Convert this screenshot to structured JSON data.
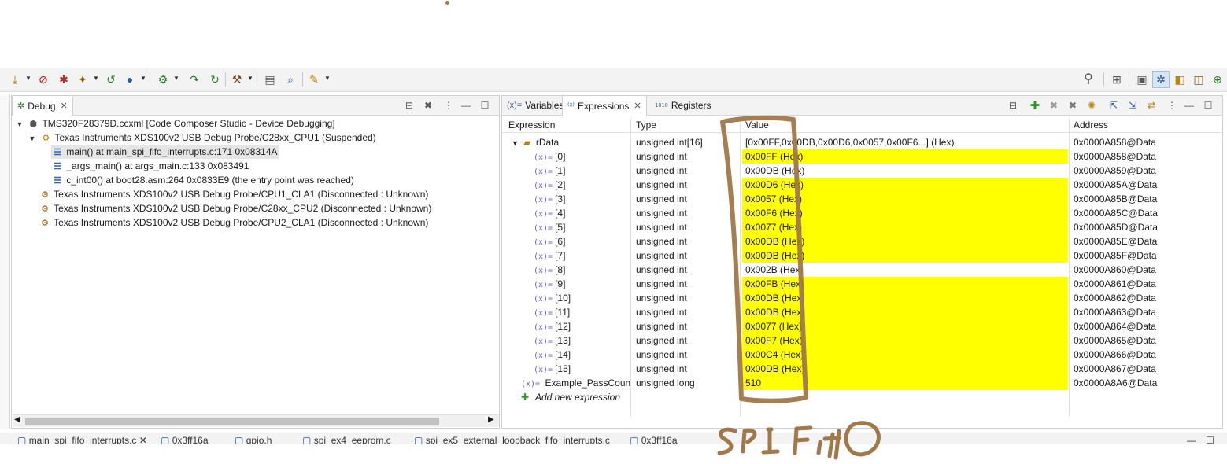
{
  "toolbar": {
    "left_icons": [
      "download-icon",
      "stop-sign-icon",
      "cpu-icon",
      "step-return-icon",
      "run-icon",
      "gear-icon",
      "step-over-icon",
      "restart-icon",
      "hammer-icon",
      "memory-icon",
      "search-target-icon",
      "wand-icon"
    ],
    "right_icons": [
      "search-icon",
      "open-perspective-icon",
      "debug-perspective-icon",
      "ccs-edit-icon",
      "ccs-debug-icon",
      "ccs-simple-icon",
      "ccs-plus-icon"
    ]
  },
  "debug_view": {
    "tab_label": "Debug",
    "tree": [
      {
        "label": "TMS320F28379D.ccxml [Code Composer Studio - Device Debugging]",
        "icon": "launch-icon"
      },
      {
        "label": "Texas Instruments XDS100v2 USB Debug Probe/C28xx_CPU1 (Suspended)",
        "icon": "thread-icon"
      },
      {
        "label": "main() at main_spi_fifo_interrupts.c:171 0x08314A",
        "icon": "stack-frame-icon"
      },
      {
        "label": "_args_main() at args_main.c:133 0x083491",
        "icon": "stack-frame-icon"
      },
      {
        "label": "c_int00() at boot28.asm:264 0x0833E9  (the entry point was reached)",
        "icon": "stack-frame-icon"
      },
      {
        "label": "Texas Instruments XDS100v2 USB Debug Probe/CPU1_CLA1 (Disconnected : Unknown)",
        "icon": "disconnected-icon"
      },
      {
        "label": "Texas Instruments XDS100v2 USB Debug Probe/C28xx_CPU2 (Disconnected : Unknown)",
        "icon": "disconnected-icon"
      },
      {
        "label": "Texas Instruments XDS100v2 USB Debug Probe/CPU2_CLA1 (Disconnected : Unknown)",
        "icon": "disconnected-icon"
      }
    ]
  },
  "expressions_view": {
    "tabs": [
      {
        "label": "Variables",
        "icon": "(x)="
      },
      {
        "label": "Expressions",
        "icon": "×"
      },
      {
        "label": "Registers",
        "icon": "1010"
      }
    ],
    "columns": [
      "Expression",
      "Type",
      "Value",
      "Address"
    ],
    "parent": {
      "name": "rData",
      "type": "unsigned int[16]",
      "value": "[0x00FF,0x00DB,0x00D6,0x0057,0x00F6...] (Hex)",
      "address": "0x0000A858@Data"
    },
    "rows": [
      {
        "name": "[0]",
        "type": "unsigned int",
        "value": "0x00FF (Hex)",
        "address": "0x0000A858@Data",
        "changed": true
      },
      {
        "name": "[1]",
        "type": "unsigned int",
        "value": "0x00DB (Hex)",
        "address": "0x0000A859@Data",
        "changed": false
      },
      {
        "name": "[2]",
        "type": "unsigned int",
        "value": "0x00D6 (Hex)",
        "address": "0x0000A85A@Data",
        "changed": true
      },
      {
        "name": "[3]",
        "type": "unsigned int",
        "value": "0x0057 (Hex)",
        "address": "0x0000A85B@Data",
        "changed": true
      },
      {
        "name": "[4]",
        "type": "unsigned int",
        "value": "0x00F6 (Hex)",
        "address": "0x0000A85C@Data",
        "changed": true
      },
      {
        "name": "[5]",
        "type": "unsigned int",
        "value": "0x0077 (Hex)",
        "address": "0x0000A85D@Data",
        "changed": true
      },
      {
        "name": "[6]",
        "type": "unsigned int",
        "value": "0x00DB (Hex)",
        "address": "0x0000A85E@Data",
        "changed": true
      },
      {
        "name": "[7]",
        "type": "unsigned int",
        "value": "0x00DB (Hex)",
        "address": "0x0000A85F@Data",
        "changed": true
      },
      {
        "name": "[8]",
        "type": "unsigned int",
        "value": "0x002B (Hex)",
        "address": "0x0000A860@Data",
        "changed": false
      },
      {
        "name": "[9]",
        "type": "unsigned int",
        "value": "0x00FB (Hex)",
        "address": "0x0000A861@Data",
        "changed": true
      },
      {
        "name": "[10]",
        "type": "unsigned int",
        "value": "0x00DB (Hex)",
        "address": "0x0000A862@Data",
        "changed": true
      },
      {
        "name": "[11]",
        "type": "unsigned int",
        "value": "0x00DB (Hex)",
        "address": "0x0000A863@Data",
        "changed": true
      },
      {
        "name": "[12]",
        "type": "unsigned int",
        "value": "0x0077 (Hex)",
        "address": "0x0000A864@Data",
        "changed": true
      },
      {
        "name": "[13]",
        "type": "unsigned int",
        "value": "0x00F7 (Hex)",
        "address": "0x0000A865@Data",
        "changed": true
      },
      {
        "name": "[14]",
        "type": "unsigned int",
        "value": "0x00C4 (Hex)",
        "address": "0x0000A866@Data",
        "changed": true
      },
      {
        "name": "[15]",
        "type": "unsigned int",
        "value": "0x00DB (Hex)",
        "address": "0x0000A867@Data",
        "changed": true
      }
    ],
    "pass_count": {
      "name": "Example_PassCount",
      "type": "unsigned long",
      "value": "510",
      "address": "0x0000A8A6@Data",
      "changed": true
    },
    "add_label": "Add new expression",
    "highlight_color": "#ffff00"
  },
  "editor_tabs": [
    "main_spi_fifo_interrupts.c",
    "0x3ff16a",
    "gpio.h",
    "spi_ex4_eeprom.c",
    "spi_ex5_external_loopback_fifo_interrupts.c",
    "0x3ff16a"
  ],
  "annotation": {
    "text": "SPI FIFO",
    "color": "#a0784a"
  }
}
